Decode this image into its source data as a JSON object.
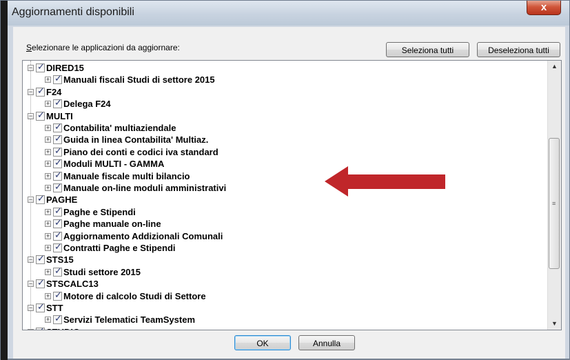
{
  "window": {
    "title": "Aggiornamenti disponibili",
    "close_label": "x"
  },
  "dialog": {
    "select_label_first": "S",
    "select_label_rest": "elezionare le applicazioni da aggiornare:",
    "select_all_label": "Seleziona tutti",
    "deselect_all_label": "Deseleziona tutti",
    "ok_label": "OK",
    "cancel_label": "Annulla"
  },
  "tree": [
    {
      "label": "DIRED15",
      "level": 0,
      "checked": true,
      "expanded": true
    },
    {
      "label": "Manuali fiscali Studi di settore 2015",
      "level": 1,
      "checked": true
    },
    {
      "label": "F24",
      "level": 0,
      "checked": true,
      "expanded": true
    },
    {
      "label": "Delega F24",
      "level": 1,
      "checked": true
    },
    {
      "label": "MULTI",
      "level": 0,
      "checked": true,
      "expanded": true
    },
    {
      "label": "Contabilita' multiaziendale",
      "level": 1,
      "checked": true
    },
    {
      "label": "Guida in linea Contabilita' Multiaz.",
      "level": 1,
      "checked": true
    },
    {
      "label": "Piano dei conti e codici iva standard",
      "level": 1,
      "checked": true
    },
    {
      "label": "Moduli MULTI - GAMMA",
      "level": 1,
      "checked": true
    },
    {
      "label": "Manuale fiscale multi bilancio",
      "level": 1,
      "checked": true
    },
    {
      "label": "Manuale on-line moduli amministrativi",
      "level": 1,
      "checked": true
    },
    {
      "label": "PAGHE",
      "level": 0,
      "checked": true,
      "expanded": true
    },
    {
      "label": "Paghe e Stipendi",
      "level": 1,
      "checked": true
    },
    {
      "label": "Paghe manuale on-line",
      "level": 1,
      "checked": true
    },
    {
      "label": "Aggiornamento Addizionali Comunali",
      "level": 1,
      "checked": true
    },
    {
      "label": "Contratti Paghe e Stipendi",
      "level": 1,
      "checked": true
    },
    {
      "label": "STS15",
      "level": 0,
      "checked": true,
      "expanded": true
    },
    {
      "label": "Studi settore 2015",
      "level": 1,
      "checked": true
    },
    {
      "label": "STSCALC13",
      "level": 0,
      "checked": true,
      "expanded": true
    },
    {
      "label": "Motore di calcolo Studi di Settore",
      "level": 1,
      "checked": true
    },
    {
      "label": "STT",
      "level": 0,
      "checked": true,
      "expanded": true
    },
    {
      "label": "Servizi Telematici TeamSystem",
      "level": 1,
      "checked": true
    },
    {
      "label": "STUDIO",
      "level": 0,
      "checked": true,
      "expanded": true
    }
  ],
  "colors": {
    "annotation_arrow": "#c0262a",
    "checkmark": "#2c3b76"
  }
}
